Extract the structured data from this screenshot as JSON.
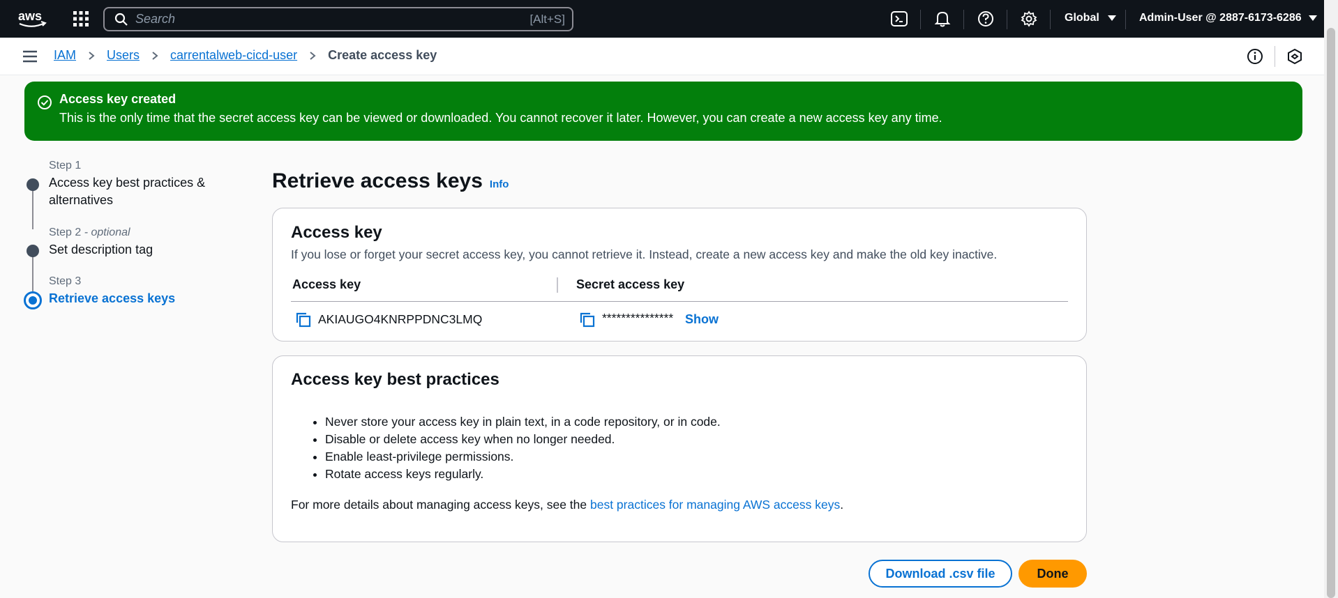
{
  "topnav": {
    "search_placeholder": "Search",
    "search_shortcut": "[Alt+S]",
    "region": "Global",
    "account": "Admin-User @ 2887-6173-6286"
  },
  "breadcrumb": {
    "items": [
      "IAM",
      "Users",
      "carrentalweb-cicd-user"
    ],
    "current": "Create access key"
  },
  "flash": {
    "title": "Access key created",
    "message": "This is the only time that the secret access key can be viewed or downloaded. You cannot recover it later. However, you can create a new access key any time.",
    "color": "#037f0c"
  },
  "steps": [
    {
      "label": "Step 1",
      "optional": "",
      "name": "Access key best practices & alternatives"
    },
    {
      "label": "Step 2",
      "optional": "- optional",
      "name": "Set description tag"
    },
    {
      "label": "Step 3",
      "optional": "",
      "name": "Retrieve access keys"
    }
  ],
  "main": {
    "title": "Retrieve access keys",
    "info_link": "Info",
    "access_key_card": {
      "heading": "Access key",
      "description": "If you lose or forget your secret access key, you cannot retrieve it. Instead, create a new access key and make the old key inactive.",
      "col_access_key": "Access key",
      "col_secret_key": "Secret access key",
      "access_key_value": "AKIAUGO4KNRPPDNC3LMQ",
      "secret_key_masked": "***************",
      "show_label": "Show"
    },
    "best_practices_card": {
      "heading": "Access key best practices",
      "items": [
        "Never store your access key in plain text, in a code repository, or in code.",
        "Disable or delete access key when no longer needed.",
        "Enable least-privilege permissions.",
        "Rotate access keys regularly."
      ],
      "more_prefix": "For more details about managing access keys, see the ",
      "more_link": "best practices for managing AWS access keys",
      "more_suffix": "."
    },
    "buttons": {
      "download": "Download .csv file",
      "done": "Done"
    }
  },
  "colors": {
    "accent": "#0972d3",
    "primary_button": "#ff9900",
    "nav_bg": "#0f141a"
  }
}
